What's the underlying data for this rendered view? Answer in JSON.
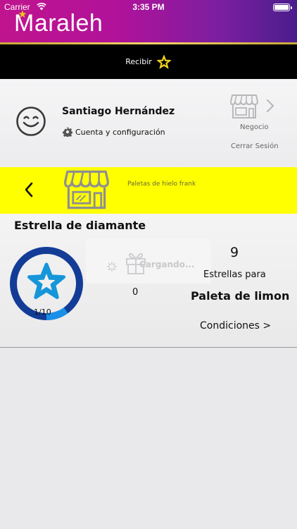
{
  "status_bar": {
    "carrier": "Carrier",
    "time": "3:35 PM"
  },
  "header": {
    "app_name": "Maraleh"
  },
  "receive_bar": {
    "label": "Recibir",
    "icon": "star-outline-icon"
  },
  "profile": {
    "user_name": "Santiago Hernández",
    "settings_label": "Cuenta y configuración",
    "business_label": "Negocio",
    "logout_label": "Cerrar Sesión"
  },
  "store_bar": {
    "shop_name": "Paletas de hielo frank"
  },
  "card": {
    "title": "Estrella de diamante",
    "progress_label": "1/10",
    "progress_fraction": 0.1,
    "loading_text": "Cargando...",
    "gift_count": "0",
    "stars_needed": "9",
    "stars_for_label": "Estrellas para",
    "reward_name": "Paleta de limon",
    "conditions_link": "Condiciones >"
  },
  "colors": {
    "header_gradient_start": "#c0148e",
    "header_gradient_end": "#4a1d8c",
    "accent_yellow": "#ffff00",
    "ring_blue_dark": "#123c96",
    "ring_blue_light": "#1a8fe8",
    "star_blue": "#1696d9"
  }
}
